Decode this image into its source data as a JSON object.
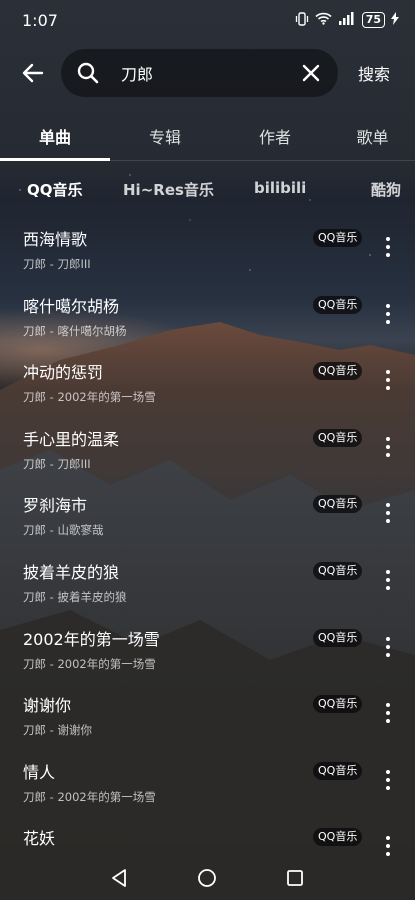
{
  "status_bar": {
    "time": "1:07",
    "battery": "75",
    "icons": [
      "vibrate-icon",
      "wifi-icon",
      "signal-icon",
      "battery-icon",
      "charging-icon"
    ]
  },
  "search": {
    "query": "刀郎",
    "submit_label": "搜索",
    "icons": {
      "back": "back-arrow-icon",
      "search": "search-icon",
      "clear": "close-icon"
    }
  },
  "tabs": [
    {
      "label": "单曲",
      "active": true
    },
    {
      "label": "专辑",
      "active": false
    },
    {
      "label": "作者",
      "active": false
    },
    {
      "label": "歌单",
      "active": false
    }
  ],
  "sources": [
    {
      "label": "QQ音乐",
      "active": true
    },
    {
      "label": "Hi~Res音乐",
      "active": false
    },
    {
      "label": "bilibili",
      "active": false
    },
    {
      "label": "酷狗",
      "active": false
    }
  ],
  "songs": [
    {
      "title": "西海情歌",
      "subtitle": "刀郎 - 刀郎III",
      "source": "QQ音乐"
    },
    {
      "title": "喀什噶尔胡杨",
      "subtitle": "刀郎 - 喀什噶尔胡杨",
      "source": "QQ音乐"
    },
    {
      "title": "冲动的惩罚",
      "subtitle": "刀郎 - 2002年的第一场雪",
      "source": "QQ音乐"
    },
    {
      "title": "手心里的温柔",
      "subtitle": "刀郎 - 刀郎III",
      "source": "QQ音乐"
    },
    {
      "title": "罗刹海市",
      "subtitle": "刀郎 - 山歌寥哉",
      "source": "QQ音乐"
    },
    {
      "title": "披着羊皮的狼",
      "subtitle": "刀郎 - 披着羊皮的狼",
      "source": "QQ音乐"
    },
    {
      "title": "2002年的第一场雪",
      "subtitle": "刀郎 - 2002年的第一场雪",
      "source": "QQ音乐"
    },
    {
      "title": "谢谢你",
      "subtitle": "刀郎 - 谢谢你",
      "source": "QQ音乐"
    },
    {
      "title": "情人",
      "subtitle": "刀郎 - 2002年的第一场雪",
      "source": "QQ音乐"
    },
    {
      "title": "花妖",
      "subtitle": "",
      "source": "QQ音乐"
    }
  ],
  "nav_bar": {
    "icons": [
      "nav-back-icon",
      "nav-home-icon",
      "nav-recents-icon"
    ]
  }
}
